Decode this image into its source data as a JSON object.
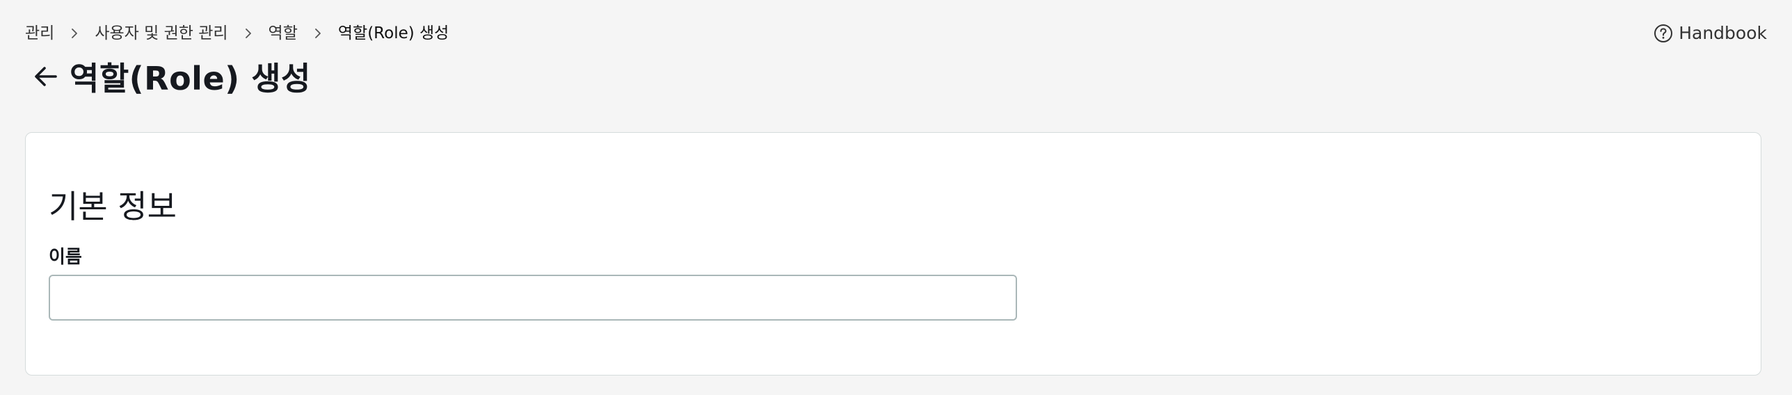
{
  "breadcrumb": {
    "items": [
      {
        "label": "관리"
      },
      {
        "label": "사용자 및 권한 관리"
      },
      {
        "label": "역할"
      },
      {
        "label": "역할(Role) 생성"
      }
    ]
  },
  "help": {
    "label": "Handbook",
    "icon": "help-circle-icon"
  },
  "header": {
    "back_icon": "arrow-left-icon",
    "title": "역할(Role) 생성"
  },
  "form": {
    "section_title": "기본 정보",
    "name_field": {
      "label": "이름",
      "value": "",
      "placeholder": ""
    }
  }
}
